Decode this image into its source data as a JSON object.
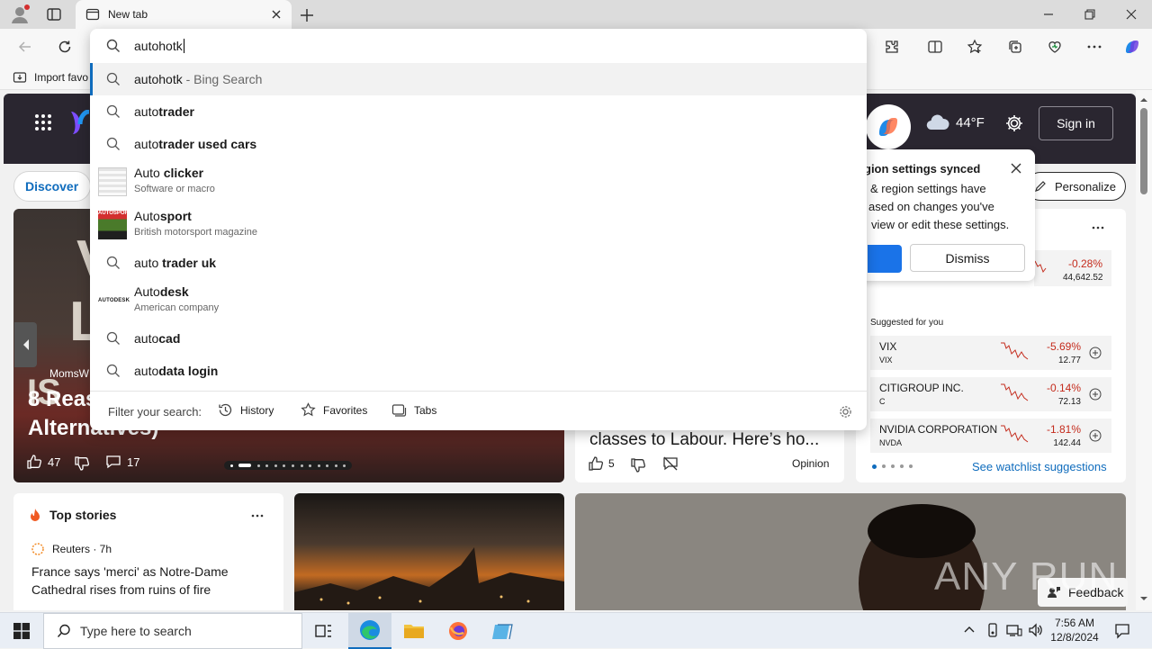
{
  "browser": {
    "tab_title": "New tab",
    "address_value": "autohotk",
    "favorites_bar": {
      "import_label": "Import favo"
    }
  },
  "omnibox": {
    "suggestions": [
      {
        "prefix": "autohotk",
        "suffix": " - Bing Search",
        "type": "search"
      },
      {
        "prefix": "auto",
        "bold": "trader",
        "type": "search"
      },
      {
        "prefix": "auto",
        "bold": "trader used cars",
        "type": "search"
      },
      {
        "prefix": "Auto ",
        "bold": "clicker",
        "subtitle": "Software or macro",
        "type": "entity"
      },
      {
        "prefix": "Auto",
        "bold": "sport",
        "subtitle": "British motorsport magazine",
        "type": "entity"
      },
      {
        "prefix": "auto",
        "bold": " trader uk",
        "type": "search"
      },
      {
        "prefix": "Auto",
        "bold": "desk",
        "subtitle": "American company",
        "type": "entity"
      },
      {
        "prefix": "auto",
        "bold": "cad",
        "type": "search"
      },
      {
        "prefix": "auto",
        "bold": "data login",
        "type": "search"
      }
    ],
    "filter_label": "Filter your search:",
    "filters": [
      "History",
      "Favorites",
      "Tabs"
    ],
    "thumb_labels": {
      "autosport": "AUTOSPORT",
      "autodesk": "AUTODESK"
    }
  },
  "page": {
    "weather": "44°F",
    "sign_in": "Sign in",
    "discover": "Discover",
    "personalize": "Personalize",
    "notification": {
      "title": "gion settings synced",
      "line1": "& region settings have",
      "line2": "ased on changes you've",
      "line3": "view or edit these settings.",
      "dismiss": "Dismiss"
    },
    "hero": {
      "big_text_1": "V",
      "big_text_2": "LE",
      "big_text_3": "IS",
      "source": "MomsW",
      "headline_1": "8 Reas",
      "headline_2": "Alternatives)",
      "likes": "47",
      "comments": "17"
    },
    "middle_card": {
      "headline": "classes to Labour. Here’s ho...",
      "likes": "5",
      "tag": "Opinion"
    },
    "market": {
      "top_change": "-0.28%",
      "top_value": "44,642.52",
      "suggested_label": "Suggested for you",
      "rows": [
        {
          "name": "VIX",
          "ticker": "VIX",
          "change": "-5.69%",
          "price": "12.77"
        },
        {
          "name": "CITIGROUP INC.",
          "ticker": "C",
          "change": "-0.14%",
          "price": "72.13"
        },
        {
          "name": "NVIDIA CORPORATION",
          "ticker": "NVDA",
          "change": "-1.81%",
          "price": "142.44"
        }
      ],
      "watchlist_link": "See watchlist suggestions"
    },
    "top_stories": {
      "title": "Top stories",
      "source": "Reuters · 7h",
      "headline": "France says 'merci' as Notre-Dame Cathedral rises from ruins of fire"
    },
    "feedback": "Feedback",
    "watermark": "ANY RUN"
  },
  "taskbar": {
    "search_placeholder": "Type here to search",
    "time": "7:56 AM",
    "date": "12/8/2024"
  },
  "colors": {
    "accent": "#0f6cbd",
    "negative": "#c42b1c",
    "edge_blue": "#1a73e8"
  }
}
